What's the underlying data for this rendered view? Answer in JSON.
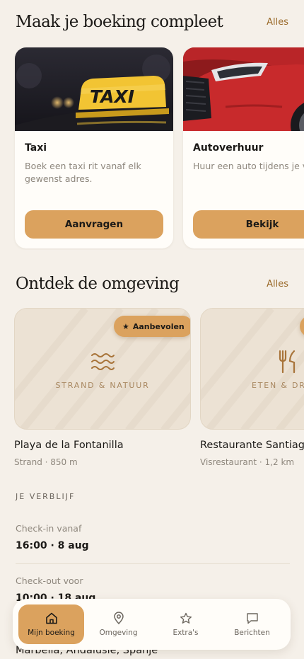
{
  "addons_section": {
    "title": "Maak je boeking compleet",
    "see_all": "Alles",
    "cards": [
      {
        "title": "Taxi",
        "description": "Boek een taxi rit vanaf elk gewenst adres.",
        "button": "Aanvragen",
        "image_sign": "TAXI"
      },
      {
        "title": "Autoverhuur",
        "description": "Huur een auto tijdens je verblijf",
        "button": "Bekijk"
      }
    ]
  },
  "explore_section": {
    "title": "Ontdek de omgeving",
    "see_all": "Alles",
    "places": [
      {
        "category": "STRAND & NATUUR",
        "name": "Playa de la Fontanilla",
        "meta": "Strand · 850 m",
        "badge": "Aanbevolen",
        "icon": "waves-icon"
      },
      {
        "category": "ETEN & DRINKEN",
        "name": "Restaurante Santiago",
        "meta": "Visrestaurant · 1,2 km",
        "icon": "cutlery-icon"
      }
    ]
  },
  "stay": {
    "heading": "JE VERBLIJF",
    "checkin_label": "Check-in vanaf",
    "checkin_value": "16:00 · 8 aug",
    "checkout_label": "Check-out voor",
    "checkout_value": "10:00 · 18 aug",
    "location": "Marbella, Andalusië, Spanje"
  },
  "tabbar": {
    "tabs": [
      {
        "label": "Mijn boeking",
        "icon": "home-icon",
        "active": true
      },
      {
        "label": "Omgeving",
        "icon": "map-pin-icon",
        "active": false
      },
      {
        "label": "Extra's",
        "icon": "star-icon",
        "active": false
      },
      {
        "label": "Berichten",
        "icon": "chat-icon",
        "active": false
      }
    ]
  },
  "colors": {
    "background": "#f5f0e9",
    "accent": "#dba25e",
    "card": "#fffdf9",
    "muted_text": "#8e877d",
    "link": "#9a6a2a"
  }
}
